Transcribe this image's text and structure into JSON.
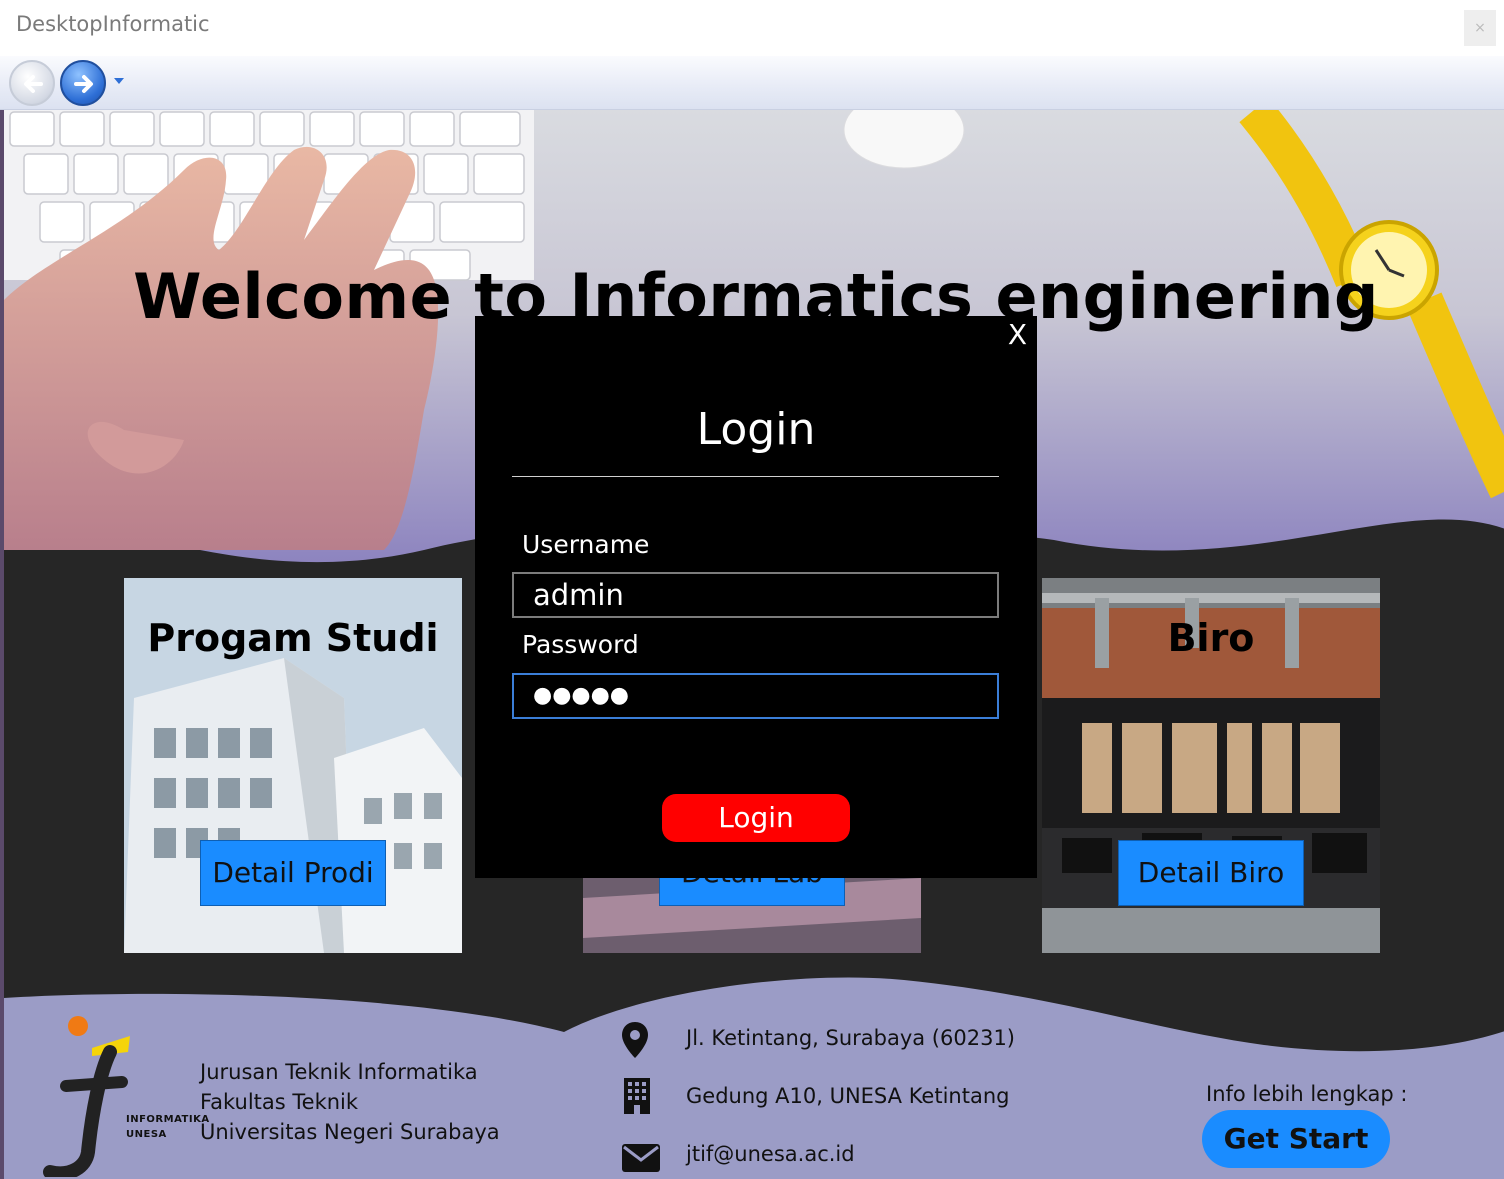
{
  "window": {
    "title": "DesktopInformatic",
    "close_label": "×"
  },
  "hero": {
    "title": "Welcome to Informatics enginering"
  },
  "cards": {
    "prodi": {
      "title": "Progam Studi",
      "button": "Detail Prodi"
    },
    "lab": {
      "title": "",
      "button": "Detail Lab"
    },
    "biro": {
      "title": "Biro",
      "button": "Detail Biro"
    }
  },
  "footer": {
    "logo_text_1": "INFORMATIKA",
    "logo_text_2": "UNESA",
    "org_line_1": "Jurusan Teknik Informatika",
    "org_line_2": "Fakultas Teknik",
    "org_line_3": "Universitas Negeri Surabaya",
    "address": "Jl. Ketintang, Surabaya (60231)",
    "building": "Gedung A10, UNESA Ketintang",
    "email": "jtif@unesa.ac.id",
    "info_label": "Info lebih lengkap :",
    "cta_button": "Get Start"
  },
  "login_modal": {
    "close_label": "X",
    "title": "Login",
    "username_label": "Username",
    "username_value": "admin",
    "password_label": "Password",
    "password_mask": "●●●●●",
    "submit_label": "Login"
  },
  "colors": {
    "accent_blue": "#1a8cff",
    "login_red": "#ff0000",
    "footer_lavender": "#9b9cc6",
    "app_dark": "#262626"
  }
}
